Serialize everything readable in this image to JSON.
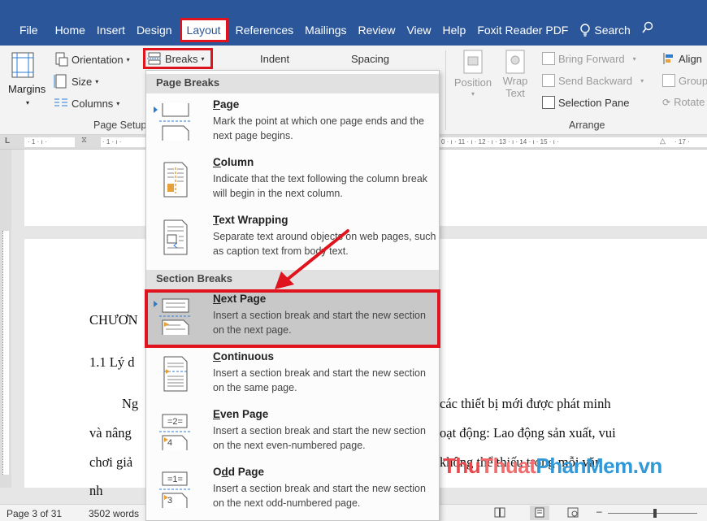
{
  "tabs": [
    "File",
    "Home",
    "Insert",
    "Design",
    "Layout",
    "References",
    "Mailings",
    "Review",
    "View",
    "Help",
    "Foxit Reader PDF"
  ],
  "search_label": "Search",
  "ribbon": {
    "margins": "Margins",
    "orientation": "Orientation",
    "size": "Size",
    "columns": "Columns",
    "breaks": "Breaks",
    "page_setup": "Page Setup",
    "indent": "Indent",
    "spacing": "Spacing",
    "position": "Position",
    "wrap_text_1": "Wrap",
    "wrap_text_2": "Text",
    "bring_forward": "Bring Forward",
    "send_backward": "Send Backward",
    "selection_pane": "Selection Pane",
    "align": "Align",
    "group": "Group",
    "rotate": "Rotate",
    "arrange": "Arrange"
  },
  "ruler": {
    "left_marks": "· 1 · ı ·",
    "mid_marks": "· 1 · ı ·",
    "right_marks": "0 · ı · 11 · ı · 12 · ı · 13 · ı · 14 · ı · 15 · ı ·",
    "end_mark": "· 17 ·"
  },
  "dropdown": {
    "page_breaks_header": "Page Breaks",
    "section_breaks_header": "Section Breaks",
    "items": [
      {
        "pre": "",
        "ul": "P",
        "post": "age",
        "desc": "Mark the point at which one page ends and the next page begins."
      },
      {
        "pre": "",
        "ul": "C",
        "post": "olumn",
        "desc": "Indicate that the text following the column break will begin in the next column."
      },
      {
        "pre": "",
        "ul": "T",
        "post": "ext Wrapping",
        "desc": "Separate text around objects on web pages, such as caption text from body text."
      },
      {
        "pre": "",
        "ul": "N",
        "post": "ext Page",
        "desc": "Insert a section break and start the new section on the next page."
      },
      {
        "pre": "",
        "ul": "C",
        "post": "ontinuous",
        "desc": "Insert a section break and start the new section on the same page."
      },
      {
        "pre": "",
        "ul": "E",
        "post": "ven Page",
        "desc": "Insert a section break and start the new section on the next even-numbered page."
      },
      {
        "pre": "O",
        "ul": "d",
        "post": "d Page",
        "desc": "Insert a section break and start the new section on the next odd-numbered page."
      }
    ]
  },
  "document": {
    "chuong": "CHƯƠN",
    "heading": "1.1 Lý d",
    "line1_left": "Ng",
    "line1_right": "các thiết bị mới được phát minh",
    "line2_left": "và nâng",
    "line2_right": "oạt động: Lao động sản xuất, vui",
    "line3_left": "chơi giả",
    "line3_right": "không thể thiếu trong mỗi văn",
    "line4_left": "nh"
  },
  "watermark": {
    "a": "Thu",
    "b": "Thuat",
    "c": "PhanMem",
    "d": ".vn"
  },
  "status": {
    "page": "Page 3 of 31",
    "words": "3502 words"
  }
}
